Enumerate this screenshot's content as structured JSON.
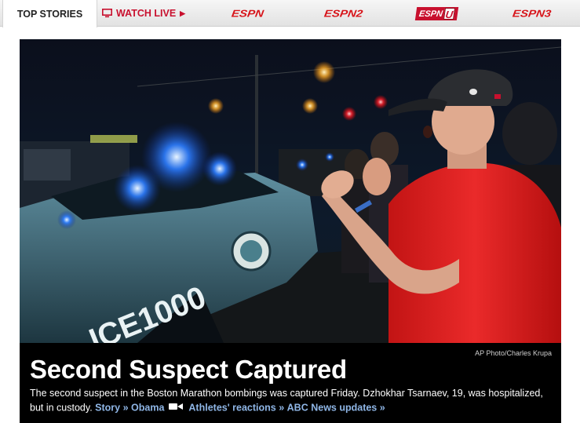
{
  "tabs": {
    "top_stories": "TOP STORIES",
    "watch_live": "WATCH LIVE",
    "espn": "ESPN",
    "espn2": "ESPN2",
    "espnu_text": "ESPN",
    "espnu_letter": "U",
    "espn3": "ESPN3"
  },
  "story": {
    "photo_credit": "AP Photo/Charles Krupa",
    "headline": "Second Suspect Captured",
    "summary": "The second suspect in the Boston Marathon bombings was captured Friday. Dzhokhar Tsarnaev, 19, was hospitalized, but in custody.",
    "links": {
      "story": "Story »",
      "obama": "Obama",
      "athletes": "Athletes' reactions »",
      "abc": "ABC News updates »"
    },
    "photo_text": "ICE1000"
  },
  "colors": {
    "accent": "#c8102e",
    "link": "#8fb6e6"
  }
}
